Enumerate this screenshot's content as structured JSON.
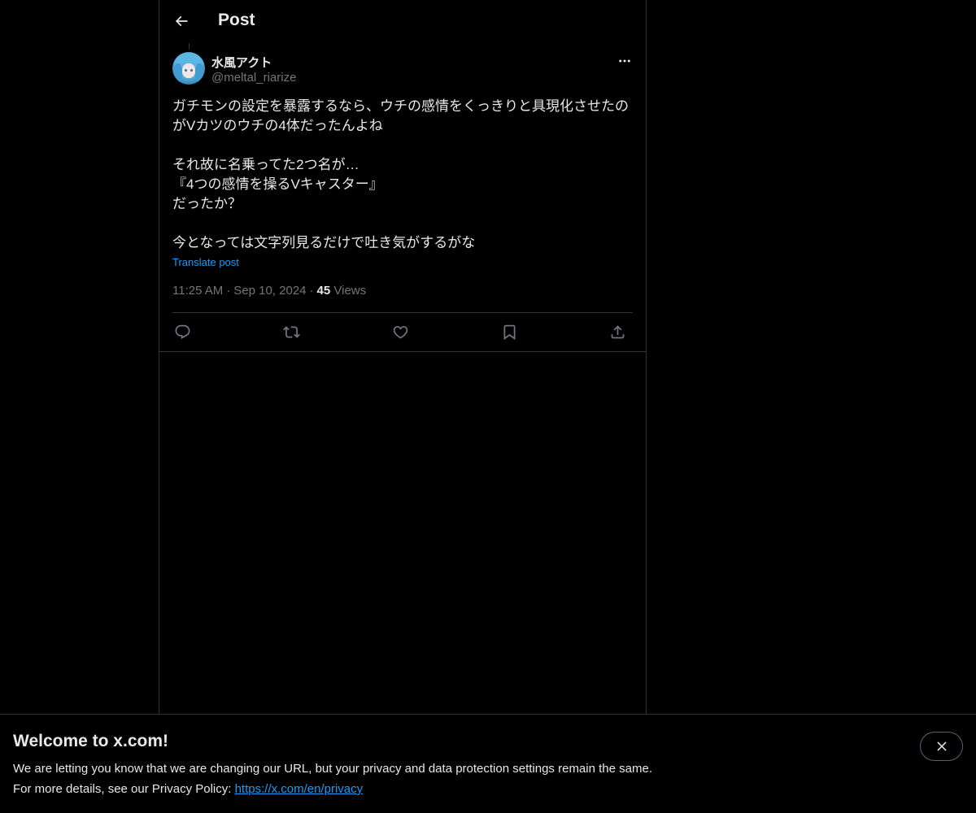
{
  "header": {
    "title": "Post",
    "back_icon": "arrow-left-icon"
  },
  "post": {
    "author": {
      "display_name": "水風アクト",
      "handle": "@meltal_riarize"
    },
    "text": "ガチモンの設定を暴露するなら、ウチの感情をくっきりと具現化させたのがVカツのウチの4体だったんよね\n\nそれ故に名乗ってた2つ名が…\n『4つの感情を操るVキャスター』\nだったか？\n\n今となっては文字列見るだけで吐き気がするがな",
    "translate_label": "Translate post",
    "time": "11:25 AM",
    "date": "Sep 10, 2024",
    "views_count": "45",
    "views_label": "Views",
    "separator": "·"
  },
  "actions": [
    {
      "name": "reply",
      "icon": "reply-icon"
    },
    {
      "name": "repost",
      "icon": "repost-icon"
    },
    {
      "name": "like",
      "icon": "heart-icon"
    },
    {
      "name": "bookmark",
      "icon": "bookmark-icon"
    },
    {
      "name": "share",
      "icon": "share-icon"
    }
  ],
  "banner": {
    "title": "Welcome to x.com!",
    "line1": "We are letting you know that we are changing our URL, but your privacy and data protection settings remain the same.",
    "line2_prefix": "For more details, see our Privacy Policy: ",
    "link": "https://x.com/en/privacy"
  },
  "colors": {
    "background": "#000000",
    "text": "#e7e9ea",
    "muted": "#71767b",
    "accent": "#1d9bf0",
    "border": "#2f3336"
  }
}
